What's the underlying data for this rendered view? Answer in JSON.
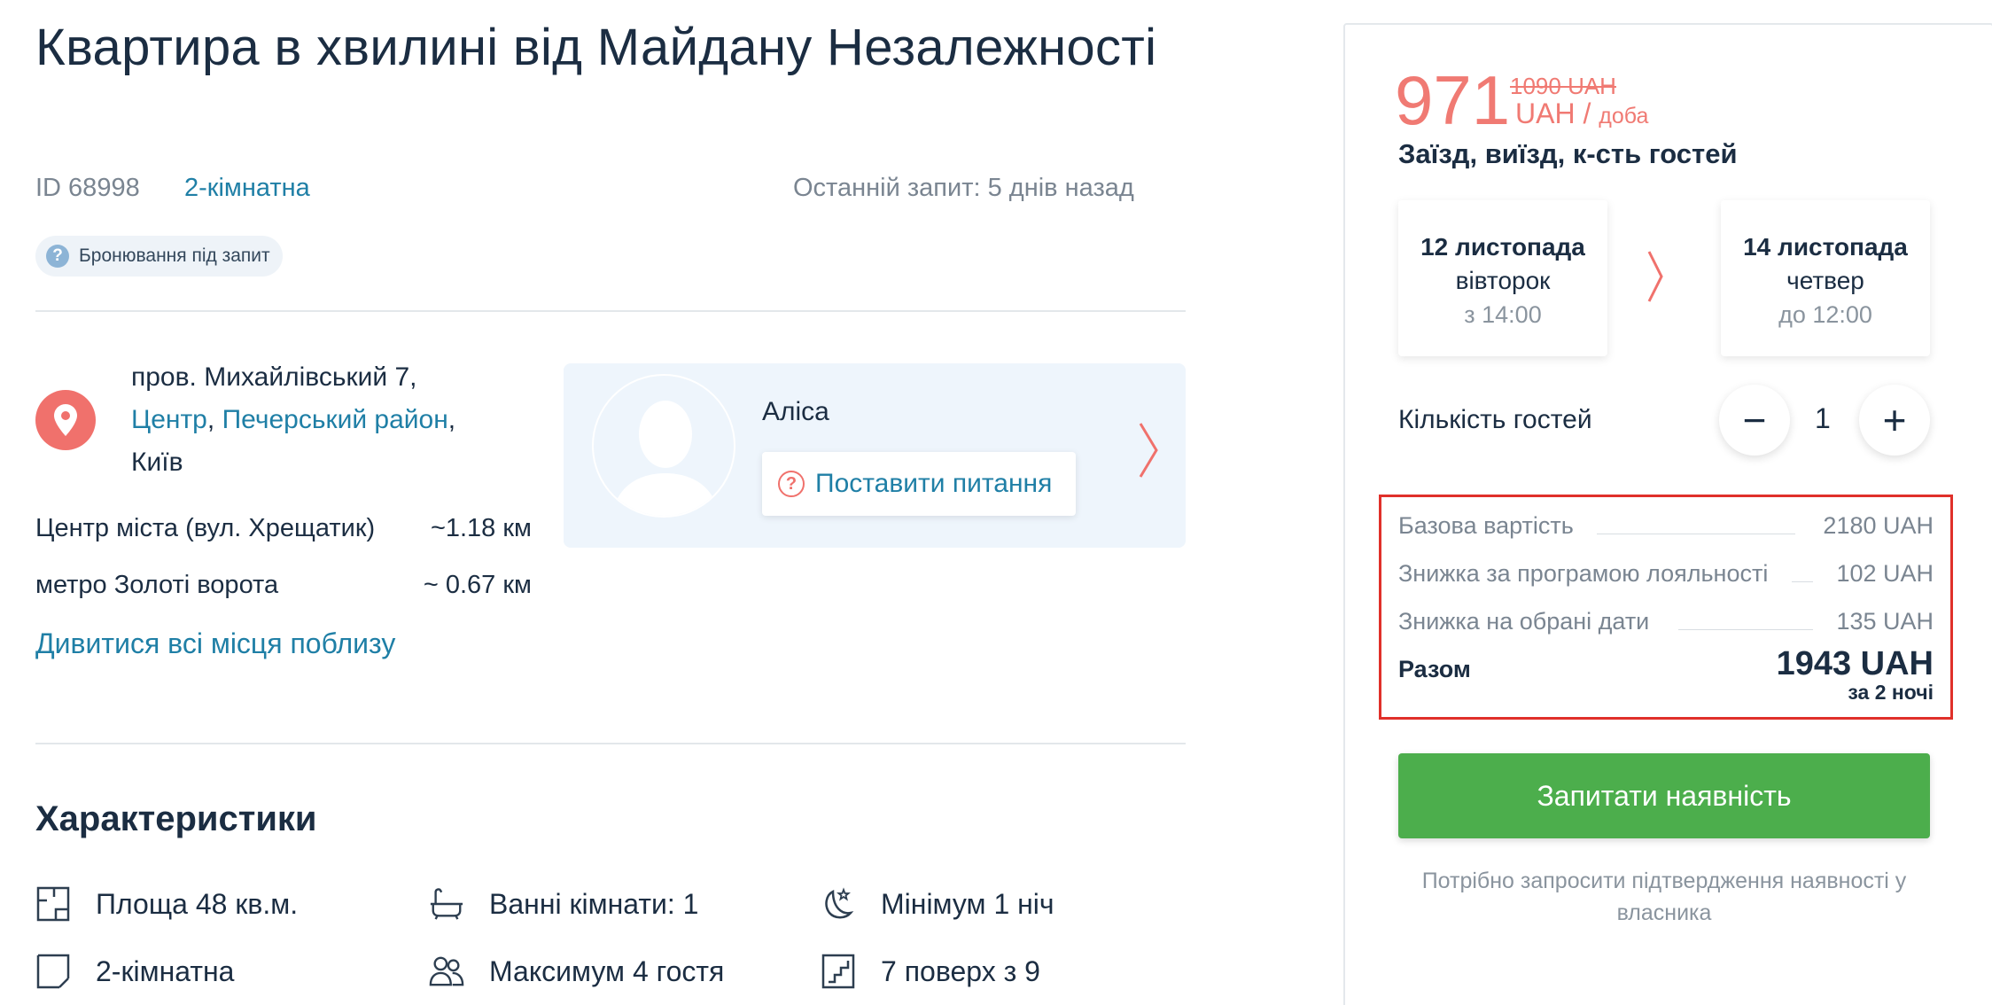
{
  "listing": {
    "title": "Квартира в хвилині від Майдану Незалежності",
    "id_label": "ID 68998",
    "rooms": "2-кімнатна",
    "last_request": "Останній запит: 5 днів назад",
    "badge": "Бронювання під запит"
  },
  "location": {
    "street": "пров. Михайлівський 7,",
    "district1": "Центр",
    "separator": ",",
    "district2": "Печерський район",
    "trailing_comma": ",",
    "city": "Київ",
    "distances": [
      {
        "label": "Центр міста (вул. Хрещатик)",
        "value": "~1.18 км",
        "is_link": false
      },
      {
        "label": "метро Золоті ворота",
        "value": "~ 0.67 км",
        "is_link": true
      }
    ],
    "all_places": "Дивитися всі місця поблизу"
  },
  "host": {
    "name": "Аліса",
    "ask_button": "Поставити питання"
  },
  "features": {
    "title": "Характеристики",
    "items": [
      {
        "icon": "floor-plan-icon",
        "label": "Площа 48 кв.м."
      },
      {
        "icon": "bathtub-icon",
        "label": "Ванні кімнати: 1"
      },
      {
        "icon": "moon-star-icon",
        "label": "Мінімум 1 ніч"
      },
      {
        "icon": "room-icon",
        "label": "2-кімнатна"
      },
      {
        "icon": "guests-icon",
        "label": "Максимум 4 гостя"
      },
      {
        "icon": "stairs-icon",
        "label": "7 поверх з 9"
      }
    ]
  },
  "booking": {
    "price": "971",
    "old_price": "1090 UAH",
    "currency": "UAH /",
    "per": "доба",
    "checkin_title": "Заїзд, виїзд, к-сть гостей",
    "checkin": {
      "date": "12 листопада",
      "weekday": "вівторок",
      "time": "з 14:00"
    },
    "checkout": {
      "date": "14 листопада",
      "weekday": "четвер",
      "time": "до 12:00"
    },
    "guests_label": "Кількість гостей",
    "guests": "1",
    "minus": "−",
    "plus": "+",
    "breakdown": [
      {
        "label": "Базова вартість",
        "value": "2180 UAH"
      },
      {
        "label": "Знижка за програмою лояльності",
        "value": "102 UAH"
      },
      {
        "label": "Знижка на обрані дати",
        "value": "135 UAH"
      }
    ],
    "total_label": "Разом",
    "total_value": "1943 UAH",
    "total_sub": "за 2 ночі",
    "cta": "Запитати наявність",
    "note": "Потрібно запросити підтвердження наявності у власника"
  },
  "colors": {
    "accent_red": "#f07a73",
    "link_blue": "#1f7fa6",
    "cta_green": "#4cae4c",
    "highlight_border": "#e0302a"
  }
}
